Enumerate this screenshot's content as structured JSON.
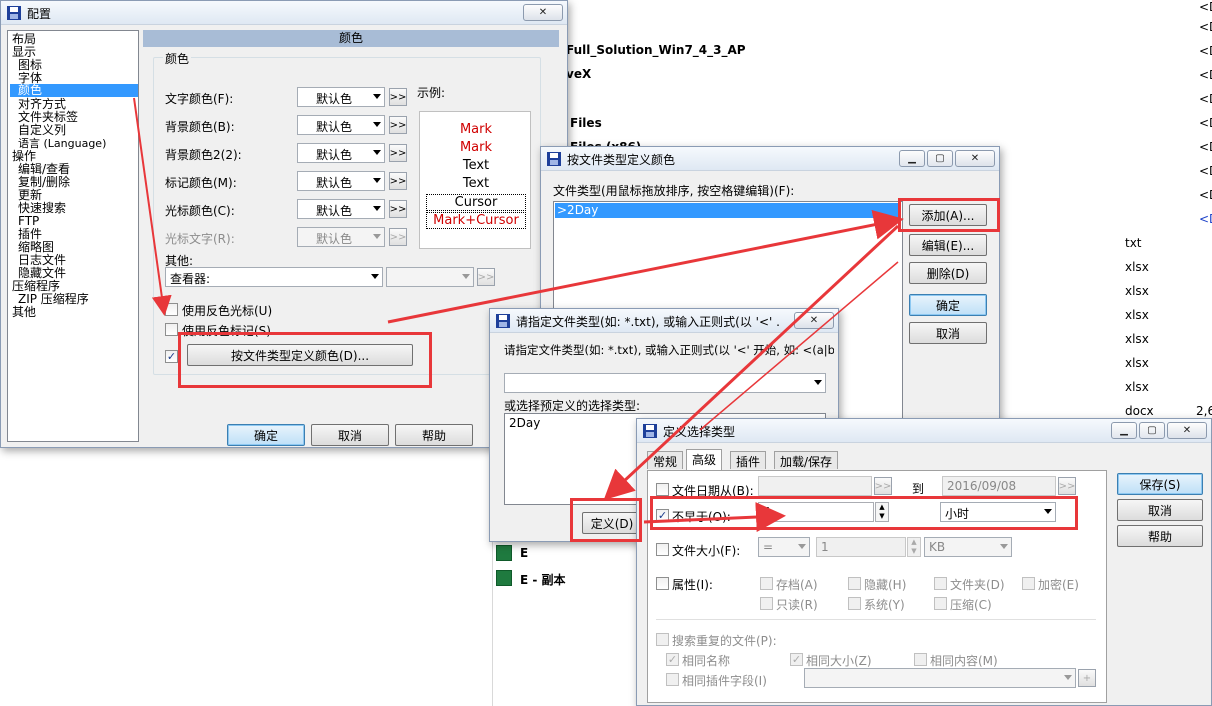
{
  "background": {
    "fragments": [
      {
        "text": "Full_Solution_Win7_4_3_AP"
      },
      {
        "text": "veX"
      },
      {
        "text": "Files"
      },
      {
        "text": "Files (x86)"
      }
    ],
    "right_col": [
      "<D",
      "<D",
      "<D",
      "<D",
      "<D",
      "<D",
      "<D",
      "<D",
      "<D",
      "<D"
    ],
    "types": [
      "txt",
      "xlsx",
      "xlsx",
      "xlsx",
      "xlsx",
      "xlsx",
      "xlsx",
      "docx"
    ],
    "size_fragment": "2,6",
    "files": [
      {
        "name": "E"
      },
      {
        "name": "E - 副本"
      }
    ]
  },
  "config": {
    "title": "配置",
    "tree": [
      "布局",
      "显示",
      "图标",
      "字体",
      "颜色",
      "对齐方式",
      "文件夹标签",
      "自定义列",
      "语言 (Language)",
      "操作",
      "编辑/查看",
      "复制/删除",
      "更新",
      "快速搜索",
      "FTP",
      "插件",
      "缩略图",
      "日志文件",
      "隐藏文件",
      "压缩程序",
      "ZIP 压缩程序",
      "其他"
    ],
    "section_header": "颜色",
    "group_label": "颜色",
    "rows": [
      {
        "label": "文字颜色(F):",
        "value": "默认色"
      },
      {
        "label": "背景颜色(B):",
        "value": "默认色"
      },
      {
        "label": "背景颜色2(2):",
        "value": "默认色"
      },
      {
        "label": "标记颜色(M):",
        "value": "默认色"
      },
      {
        "label": "光标颜色(C):",
        "value": "默认色"
      },
      {
        "label": "光标文字(R):",
        "value": "默认色"
      }
    ],
    "more_label": ">>",
    "example_label": "示例:",
    "example": [
      "Mark",
      "Mark",
      "Text",
      "Text",
      "Cursor",
      "Mark+Cursor"
    ],
    "other_label": "其他:",
    "other_value": "查看器:",
    "check_inverse_cursor": "使用反色光标(U)",
    "check_inverse_mark": "使用反色标记(S)",
    "define_colors_button": "按文件类型定义颜色(D)...",
    "ok": "确定",
    "cancel": "取消",
    "help": "帮助"
  },
  "filetype_colors": {
    "title": "按文件类型定义颜色",
    "list_label": "文件类型(用鼠标拖放排序, 按空格键编辑)(F):",
    "items": [
      ">2Day"
    ],
    "add": "添加(A)...",
    "edit": "编辑(E)...",
    "delete": "删除(D)",
    "ok": "确定",
    "cancel": "取消"
  },
  "specify_type": {
    "title": "请指定文件类型(如: *.txt), 或输入正则式(以 '<' ...",
    "prompt": "请指定文件类型(如: *.txt), 或输入正则式(以 '<' 开始, 如: <(a|b))",
    "value": "",
    "predefined_label": "或选择预定义的选择类型:",
    "predefined_items": [
      "2Day"
    ],
    "define_button": "定义(D)"
  },
  "define_sel": {
    "title": "定义选择类型",
    "tabs": [
      "常规",
      "高级",
      "插件",
      "加载/保存"
    ],
    "active_tab": "高级",
    "date_from_label": "文件日期从(B):",
    "to_label": "到",
    "date_to_value": "2016/09/08",
    "not_older_label": "不早于(O):",
    "not_older_value": "4",
    "unit_value": "小时",
    "size_label": "文件大小(F):",
    "size_op": "=",
    "size_value": "1",
    "size_unit": "KB",
    "attr_label": "属性(I):",
    "attrs": [
      "存档(A)",
      "隐藏(H)",
      "文件夹(D)",
      "加密(E)",
      "只读(R)",
      "系统(Y)",
      "压缩(C)"
    ],
    "dup_label": "搜索重复的文件(P):",
    "dup_opts": [
      "相同名称",
      "相同大小(Z)",
      "相同内容(M)",
      "相同插件字段(I)"
    ],
    "save": "保存(S)",
    "cancel": "取消",
    "help": "帮助"
  },
  "colors": {
    "accent": "#3399ff",
    "annotation": "#e8373a",
    "example_red": "#d00000"
  }
}
